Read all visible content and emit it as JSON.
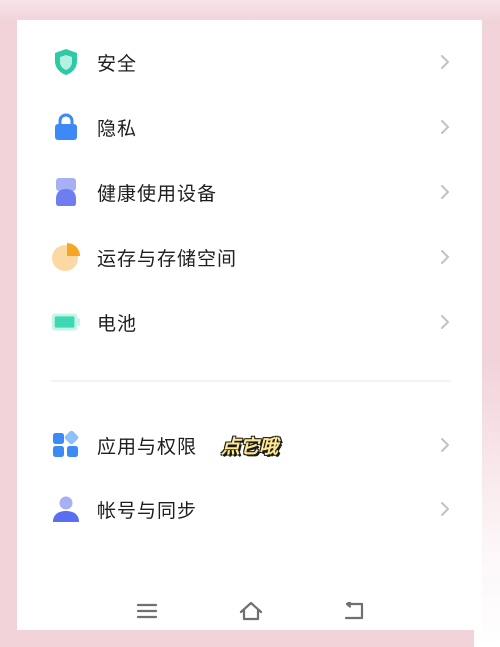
{
  "settings": {
    "items": [
      {
        "label": "安全",
        "icon": "shield-icon",
        "color": "#2dcaa5"
      },
      {
        "label": "隐私",
        "icon": "lock-icon",
        "color": "#3d8af7"
      },
      {
        "label": "健康使用设备",
        "icon": "health-device-icon",
        "color": "#6e7ef0"
      },
      {
        "label": "运存与存储空间",
        "icon": "storage-pie-icon",
        "color": "#f5a623"
      },
      {
        "label": "电池",
        "icon": "battery-icon",
        "color": "#3dd9b3"
      }
    ],
    "items_group2": [
      {
        "label": "应用与权限",
        "icon": "apps-icon",
        "color": "#3d8af7",
        "sticker": "点它哦"
      },
      {
        "label": "帐号与同步",
        "icon": "account-icon",
        "color": "#5b6df0"
      }
    ]
  },
  "navbar": {
    "buttons": [
      "menu-icon",
      "home-icon",
      "back-icon"
    ]
  }
}
